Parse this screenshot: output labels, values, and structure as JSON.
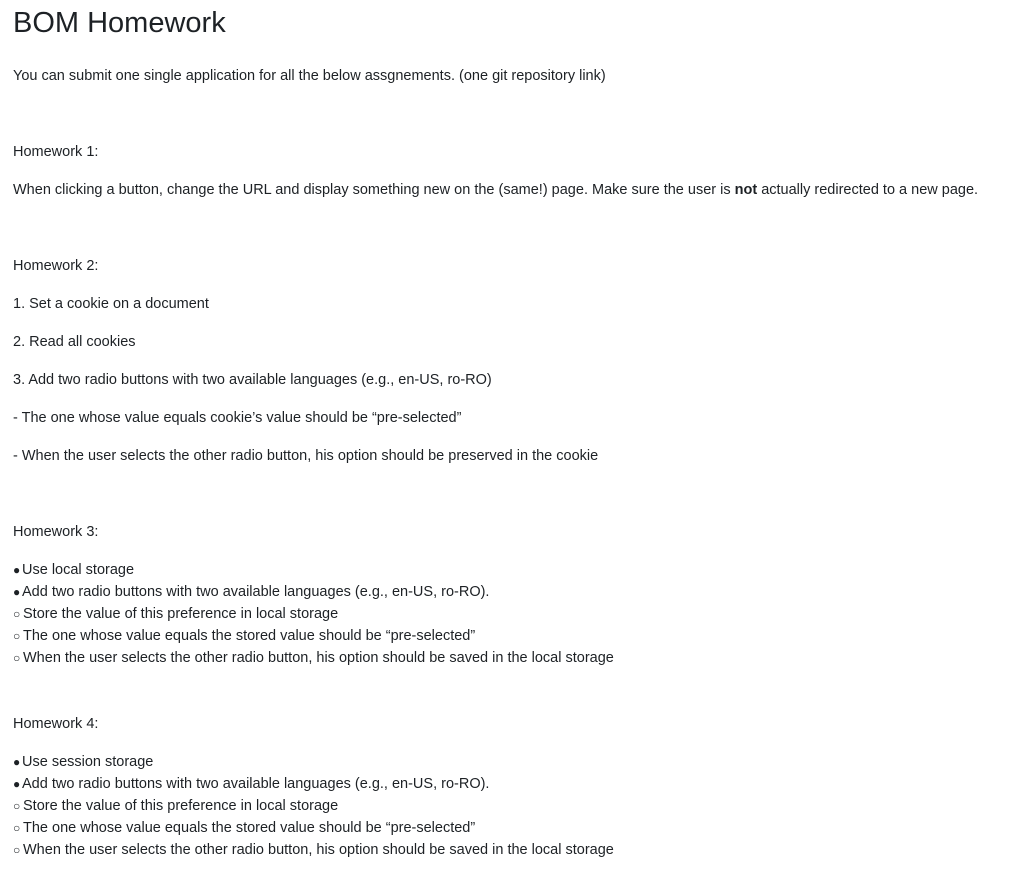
{
  "title": "BOM Homework",
  "intro": "You can submit one single application for all the below assgnements. (one git repository link)",
  "hw1": {
    "heading": "Homework 1:",
    "text_before": "When clicking a button, change the URL and display something new on the (same!) page. Make sure the user is ",
    "text_bold": "not",
    "text_after": " actually redirected to a new page."
  },
  "hw2": {
    "heading": "Homework 2:",
    "items": [
      "1. Set a cookie on a document",
      "2. Read all cookies",
      "3. Add two radio buttons with two available languages (e.g., en-US, ro-RO)",
      "- The one whose value equals cookie’s value should be “pre-selected”",
      "- When the user selects the other radio button, his option should be preserved in the cookie"
    ]
  },
  "hw3": {
    "heading": "Homework 3:",
    "items": [
      {
        "marker": "●",
        "text": "Use local storage"
      },
      {
        "marker": "●",
        "text": "Add two radio buttons with two available languages (e.g., en-US, ro-RO)."
      },
      {
        "marker": "○",
        "text": "Store the value of this preference in local storage"
      },
      {
        "marker": "○",
        "text": "The one whose value equals the stored value should be “pre-selected”"
      },
      {
        "marker": "○",
        "text": "When the user selects the other radio button, his option should be saved in the local storage"
      }
    ]
  },
  "hw4": {
    "heading": "Homework 4:",
    "items": [
      {
        "marker": "●",
        "text": "Use session storage"
      },
      {
        "marker": "●",
        "text": "Add two radio buttons with two available languages (e.g., en-US, ro-RO)."
      },
      {
        "marker": "○",
        "text": "Store the value of this preference in local storage"
      },
      {
        "marker": "○",
        "text": "The one whose value equals the stored value should be “pre-selected”"
      },
      {
        "marker": "○",
        "text": "When the user selects the other radio button, his option should be saved in the local storage"
      }
    ]
  }
}
